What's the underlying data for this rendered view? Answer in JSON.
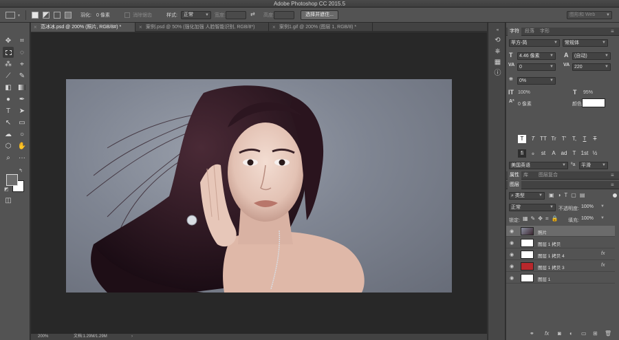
{
  "app": {
    "title": "Adobe Photoshop CC 2015.5"
  },
  "options": {
    "feather_label": "羽化:",
    "feather_value": "0 像素",
    "antialias_label": "消除锯齿",
    "style_label": "样式:",
    "style_value": "正常",
    "width_label": "宽度:",
    "height_label": "高度:",
    "refine_button": "选择并遮住...",
    "workspace": "图形和 Web"
  },
  "tabs": [
    {
      "label": "范冰冰.psd @ 200% (照片, RGB/8#) *",
      "active": true
    },
    {
      "label": "案例.psd @ 50% (强化加强 人脸智能识别, RGB/8*)",
      "active": false
    },
    {
      "label": "案例1.gif @ 200% (图层 1, RGB/8) *",
      "active": false
    }
  ],
  "status": {
    "zoom": "200%",
    "doc": "文档:1.29M/1.29M"
  },
  "character": {
    "tabs": [
      "字符",
      "段落",
      "字形"
    ],
    "font_family": "苹方-简",
    "font_style": "常规体",
    "size": "4.46 像素",
    "leading": "(自动)",
    "kerning": "0",
    "tracking": "220",
    "vscale_pct": "0%",
    "vscale": "100%",
    "hscale": "95%",
    "baseline": "0 像素",
    "color_label": "颜色:",
    "language": "美国英语",
    "antialias": "平滑",
    "style_row1": [
      "T",
      "T",
      "TT",
      "Tr",
      "T'",
      "T,",
      "T",
      "T"
    ],
    "style_row2": [
      "fi",
      "ℴ",
      "st",
      "A",
      "ad",
      "T",
      "1st",
      "½"
    ]
  },
  "properties_tabs": [
    "属性",
    "库",
    "图层复合"
  ],
  "layers": {
    "tab": "图层",
    "filter": "类型",
    "blend": "正常",
    "opacity_label": "不透明度:",
    "opacity": "100%",
    "lock_label": "锁定:",
    "fill_label": "填充:",
    "fill": "100%",
    "items": [
      {
        "name": "照片",
        "thumb": "photo",
        "selected": true,
        "fx": ""
      },
      {
        "name": "图层 1 拷贝",
        "thumb": "#ffffff",
        "selected": false,
        "fx": ""
      },
      {
        "name": "图层 1 拷贝 4",
        "thumb": "#ffffff",
        "selected": false,
        "fx": "fx"
      },
      {
        "name": "图层 1 拷贝 3",
        "thumb": "#b8282c",
        "selected": false,
        "fx": "fx"
      },
      {
        "name": "图层 1",
        "thumb": "#ffffff",
        "selected": false,
        "fx": ""
      }
    ]
  }
}
